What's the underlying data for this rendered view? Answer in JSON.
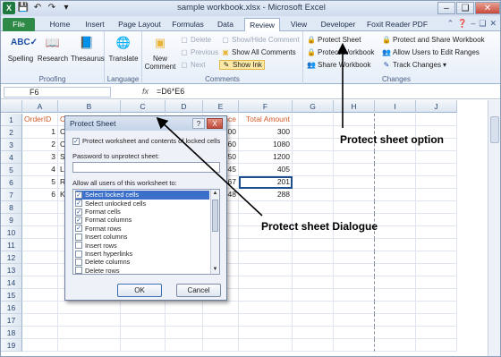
{
  "window": {
    "title": "sample workbook.xlsx - Microsoft Excel",
    "qat": [
      "excel-app-icon",
      "save-icon",
      "undo-icon",
      "redo-icon",
      "customize-icon"
    ]
  },
  "tabs": [
    "File",
    "Home",
    "Insert",
    "Page Layout",
    "Formulas",
    "Data",
    "Review",
    "View",
    "Developer",
    "Foxit Reader PDF"
  ],
  "active_tab": "Review",
  "ribbon": {
    "proofing": {
      "label": "Proofing",
      "spelling": "Spelling",
      "research": "Research",
      "thesaurus": "Thesaurus"
    },
    "language": {
      "label": "Language",
      "translate": "Translate"
    },
    "comments": {
      "label": "Comments",
      "new_comment": "New Comment",
      "delete": "Delete",
      "previous": "Previous",
      "next": "Next",
      "show_hide_comment": "Show/Hide Comment",
      "show_all_comments": "Show All Comments",
      "show_ink": "Show Ink"
    },
    "changes": {
      "label": "Changes",
      "protect_sheet": "Protect Sheet",
      "protect_workbook": "Protect Workbook",
      "share_workbook": "Share Workbook",
      "protect_and_share": "Protect and Share Workbook",
      "allow_users": "Allow Users to Edit Ranges",
      "track_changes": "Track Changes"
    }
  },
  "formula_bar": {
    "name_box": "F6",
    "fx": "fx",
    "formula": "=D6*E6"
  },
  "columns": [
    "A",
    "B",
    "C",
    "D",
    "E",
    "F",
    "G",
    "H",
    "I",
    "J"
  ],
  "rows": [
    "1",
    "2",
    "3",
    "4",
    "5",
    "6",
    "7",
    "8",
    "9",
    "10",
    "11",
    "12",
    "13",
    "14",
    "15",
    "16",
    "17",
    "18",
    "19"
  ],
  "cells": {
    "A1": "OrderID",
    "B1": "C",
    "E1": "Price",
    "F1": "Total Amount",
    "A2": "1",
    "B2": "Ca",
    "E2": "100",
    "F2": "300",
    "A3": "2",
    "B3": "Ca",
    "E3": "60",
    "F3": "1080",
    "A4": "3",
    "B4": "Sm",
    "E4": "50",
    "F4": "1200",
    "A5": "4",
    "B5": "Lu",
    "E5": "45",
    "F5": "405",
    "A6": "5",
    "B6": "Re",
    "E6": "67",
    "F6": "201",
    "A7": "6",
    "B7": "Ke",
    "E7": "48",
    "F7": "288"
  },
  "dialog": {
    "title": "Protect Sheet",
    "help": "?",
    "close": "X",
    "protect_check_label": "Protect worksheet and contents of locked cells",
    "password_label": "Password to unprotect sheet:",
    "allow_label": "Allow all users of this worksheet to:",
    "permissions": [
      {
        "label": "Select locked cells",
        "checked": true,
        "selected": true
      },
      {
        "label": "Select unlocked cells",
        "checked": true,
        "selected": false
      },
      {
        "label": "Format cells",
        "checked": true,
        "selected": false
      },
      {
        "label": "Format columns",
        "checked": true,
        "selected": false
      },
      {
        "label": "Format rows",
        "checked": true,
        "selected": false
      },
      {
        "label": "Insert columns",
        "checked": false,
        "selected": false
      },
      {
        "label": "Insert rows",
        "checked": false,
        "selected": false
      },
      {
        "label": "Insert hyperlinks",
        "checked": false,
        "selected": false
      },
      {
        "label": "Delete columns",
        "checked": false,
        "selected": false
      },
      {
        "label": "Delete rows",
        "checked": false,
        "selected": false
      }
    ],
    "ok": "OK",
    "cancel": "Cancel"
  },
  "annotations": {
    "protect_sheet_option": "Protect sheet option",
    "protect_sheet_dialogue": "Protect sheet Dialogue"
  }
}
